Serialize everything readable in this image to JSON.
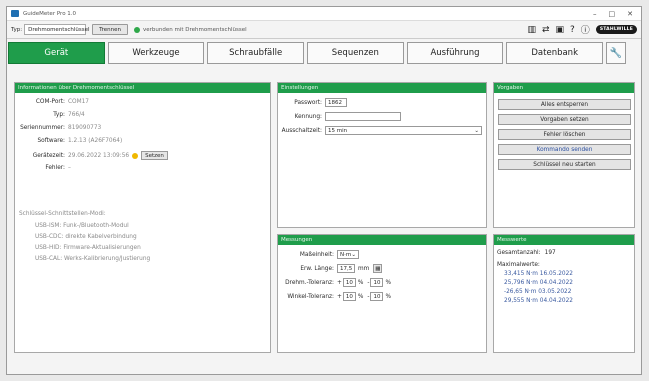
{
  "window": {
    "title": "GuideMeter Pro 1.0",
    "min": "–",
    "max": "□",
    "close": "✕"
  },
  "toolbar": {
    "type_label": "Typ:",
    "type_value": "Drehmomentschlüssel",
    "disconnect_label": "Trennen",
    "status_text": "verbunden mit Drehmomentschlüssel",
    "status_color": "#2fa84a",
    "icons": [
      "barcode-icon",
      "transfer-icon",
      "save-icon",
      "help-icon",
      "info-icon"
    ],
    "brand": "STAHLWILLE"
  },
  "tabs": [
    {
      "label": "Gerät",
      "active": true
    },
    {
      "label": "Werkzeuge"
    },
    {
      "label": "Schraubfälle"
    },
    {
      "label": "Sequenzen"
    },
    {
      "label": "Ausführung"
    },
    {
      "label": "Datenbank"
    }
  ],
  "info": {
    "header": "Informationen über Drehmomentschlüssel",
    "com_port_label": "COM-Port:",
    "com_port": "COM17",
    "typ_label": "Typ:",
    "typ": "766/4",
    "serial_label": "Seriennummer:",
    "serial": "819090773",
    "software_label": "Software:",
    "software": "1.2.13 (A26F7064)",
    "time_label": "Gerätezeit:",
    "time": "29.06.2022 13:09:56",
    "set_label": "Setzen",
    "error_label": "Fehler:",
    "error": "–",
    "interfaces_title": "Schlüssel-Schnittstellen-Modi:",
    "interfaces": [
      "USB-ISM: Funk-/Bluetooth-Modul",
      "USB-CDC: direkte Kabelverbindung",
      "USB-HID: Firmware-Aktualisierungen",
      "USB-CAL: Werks-Kalibrierung/Justierung"
    ]
  },
  "settings": {
    "header": "Einstellungen",
    "password_label": "Passwort:",
    "password": "1862",
    "id_label": "Kennung:",
    "id_value": "",
    "timeout_label": "Ausschaltzeit:",
    "timeout": "15 min"
  },
  "measure": {
    "header": "Messungen",
    "unit_label": "Maßeinheit:",
    "unit": "N·m",
    "ext_label": "Erw. Länge:",
    "ext": "17,5",
    "ext_unit": "mm",
    "torque_label": "Drehm.-Toleranz:",
    "torque_minus": "10",
    "torque_plus": "10",
    "pct": "%",
    "angle_label": "Winkel-Toleranz:",
    "angle_minus": "10",
    "angle_plus": "10",
    "minus_sign": "-",
    "plus_sign": "+"
  },
  "presets": {
    "header": "Vorgaben",
    "buttons": [
      "Alles entsperren",
      "Vorgaben setzen",
      "Fehler löschen",
      "Kommando senden",
      "Schlüssel neu starten"
    ]
  },
  "values": {
    "header": "Messwerte",
    "total_label": "Gesamtanzahl:",
    "total": "197",
    "max_label": "Maximalwerte:",
    "max_rows": [
      "33,415 N·m  16.05.2022",
      "25,796 N·m  04.04.2022",
      "-26,65 N·m  03.05.2022",
      "29,555 N·m  04.04.2022"
    ]
  }
}
